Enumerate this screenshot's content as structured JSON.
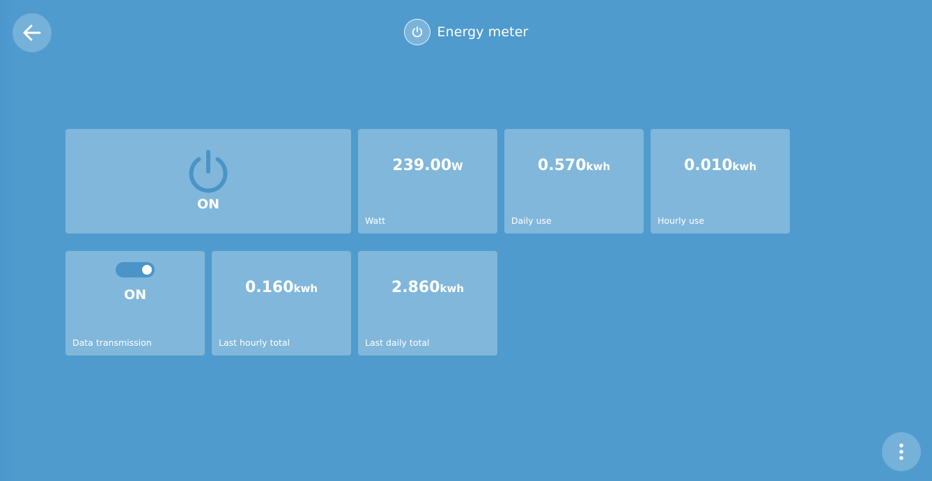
{
  "header": {
    "title": "Energy meter",
    "icon": "power-icon"
  },
  "nav": {
    "back_icon": "arrow-left-icon",
    "menu_icon": "more-vertical-icon"
  },
  "tiles": {
    "power": {
      "state": "ON",
      "icon": "power-icon"
    },
    "watt": {
      "value": "239.00",
      "unit": "W",
      "label": "Watt"
    },
    "daily_use": {
      "value": "0.570",
      "unit": "kwh",
      "label": "Daily use"
    },
    "hourly_use": {
      "value": "0.010",
      "unit": "kwh",
      "label": "Hourly use"
    },
    "data_transmission": {
      "state": "ON",
      "label": "Data transmission",
      "toggle_on": true
    },
    "last_hourly_total": {
      "value": "0.160",
      "unit": "kwh",
      "label": "Last hourly total"
    },
    "last_daily_total": {
      "value": "2.860",
      "unit": "kwh",
      "label": "Last daily total"
    }
  },
  "colors": {
    "background": "#4f9bce",
    "tile": "#82b6da",
    "accent": "#4a94c7",
    "text": "#ffffff"
  }
}
